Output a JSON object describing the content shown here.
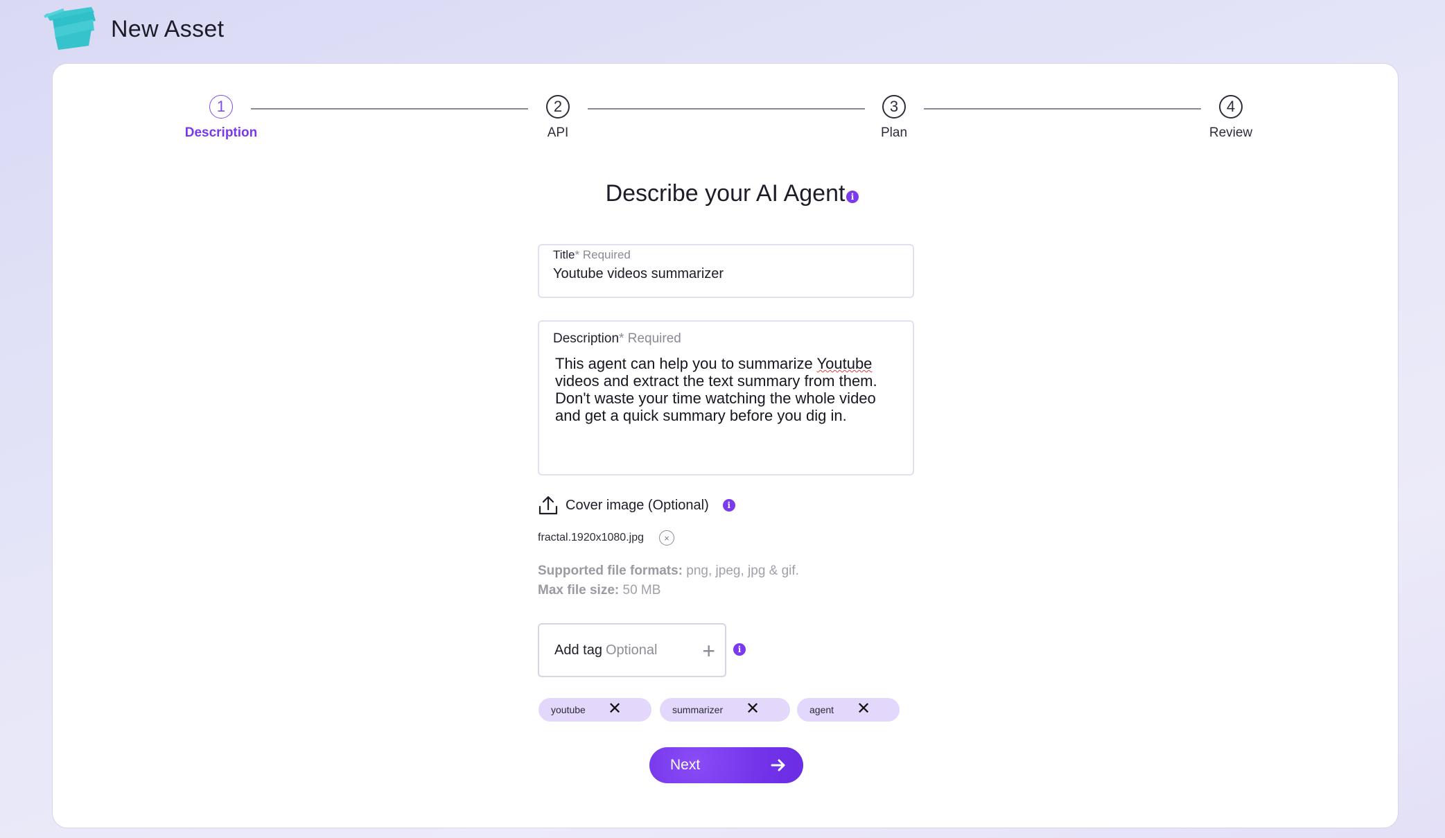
{
  "header": {
    "title": "New Asset"
  },
  "stepper": {
    "steps": [
      {
        "number": "1",
        "label": "Description"
      },
      {
        "number": "2",
        "label": "API"
      },
      {
        "number": "3",
        "label": "Plan"
      },
      {
        "number": "4",
        "label": "Review"
      }
    ],
    "active_step": 1
  },
  "form": {
    "heading": "Describe your AI Agent",
    "title_field": {
      "label": "Title",
      "asterisk": "*",
      "required": "Required",
      "value": "Youtube videos summarizer"
    },
    "description_field": {
      "label": "Description",
      "asterisk": "*",
      "required": "Required",
      "line1_pre": "This agent can help you to summarize ",
      "line1_misspelled": "Youtube",
      "line2": "videos and extract the text summary from them.",
      "line3": "Don't waste your time watching the whole video",
      "line4": "and get a quick summary before you dig in."
    },
    "cover_image": {
      "label": "Cover image (Optional)",
      "file_name": "fractal.1920x1080.jpg",
      "formats_label": "Supported file formats:",
      "formats_value": "png, jpeg, jpg & gif.",
      "size_label": "Max file size:",
      "size_value": "50 MB"
    },
    "tag_input": {
      "label": "Add tag",
      "optional": "Optional",
      "plus": "+"
    },
    "tags": [
      {
        "label": "youtube"
      },
      {
        "label": "summarizer"
      },
      {
        "label": "agent"
      }
    ],
    "next_button": {
      "label": "Next"
    },
    "info_glyph": "i",
    "close_glyph": "×",
    "chip_close_glyph": "✕"
  },
  "colors": {
    "accent": "#7c3aed",
    "chip_bg": "#e3d8fb",
    "logo": "#3cc7cf"
  },
  "icons": [
    "logo-icon",
    "info-icon",
    "upload-icon",
    "close-icon",
    "plus-icon",
    "arrow-right-icon"
  ]
}
